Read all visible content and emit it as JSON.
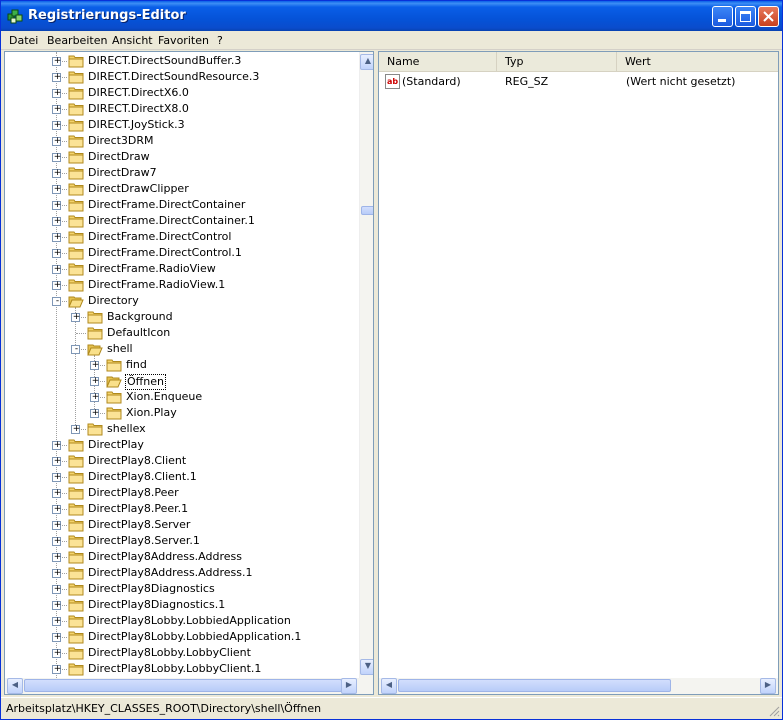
{
  "window": {
    "title": "Registrierungs-Editor"
  },
  "menu": [
    {
      "label": "Datei"
    },
    {
      "label": "Bearbeiten"
    },
    {
      "label": "Ansicht"
    },
    {
      "label": "Favoriten"
    },
    {
      "label": "?"
    }
  ],
  "tree": [
    {
      "label": "DIRECT.DirectSoundBuffer.3",
      "depth": 0,
      "expander": "+"
    },
    {
      "label": "DIRECT.DirectSoundResource.3",
      "depth": 0,
      "expander": "+"
    },
    {
      "label": "DIRECT.DirectX6.0",
      "depth": 0,
      "expander": "+"
    },
    {
      "label": "DIRECT.DirectX8.0",
      "depth": 0,
      "expander": "+"
    },
    {
      "label": "DIRECT.JoyStick.3",
      "depth": 0,
      "expander": "+"
    },
    {
      "label": "Direct3DRM",
      "depth": 0,
      "expander": "+"
    },
    {
      "label": "DirectDraw",
      "depth": 0,
      "expander": "+"
    },
    {
      "label": "DirectDraw7",
      "depth": 0,
      "expander": "+"
    },
    {
      "label": "DirectDrawClipper",
      "depth": 0,
      "expander": "+"
    },
    {
      "label": "DirectFrame.DirectContainer",
      "depth": 0,
      "expander": "+"
    },
    {
      "label": "DirectFrame.DirectContainer.1",
      "depth": 0,
      "expander": "+"
    },
    {
      "label": "DirectFrame.DirectControl",
      "depth": 0,
      "expander": "+"
    },
    {
      "label": "DirectFrame.DirectControl.1",
      "depth": 0,
      "expander": "+"
    },
    {
      "label": "DirectFrame.RadioView",
      "depth": 0,
      "expander": "+"
    },
    {
      "label": "DirectFrame.RadioView.1",
      "depth": 0,
      "expander": "+"
    },
    {
      "label": "Directory",
      "depth": 0,
      "expander": "-"
    },
    {
      "label": "Background",
      "depth": 1,
      "expander": "+"
    },
    {
      "label": "DefaultIcon",
      "depth": 1,
      "expander": ""
    },
    {
      "label": "shell",
      "depth": 1,
      "expander": "-"
    },
    {
      "label": "find",
      "depth": 2,
      "expander": "+"
    },
    {
      "label": "Öffnen",
      "depth": 2,
      "expander": "+",
      "selected": true
    },
    {
      "label": "Xion.Enqueue",
      "depth": 2,
      "expander": "+"
    },
    {
      "label": "Xion.Play",
      "depth": 2,
      "expander": "+"
    },
    {
      "label": "shellex",
      "depth": 1,
      "expander": "+"
    },
    {
      "label": "DirectPlay",
      "depth": 0,
      "expander": "+"
    },
    {
      "label": "DirectPlay8.Client",
      "depth": 0,
      "expander": "+"
    },
    {
      "label": "DirectPlay8.Client.1",
      "depth": 0,
      "expander": "+"
    },
    {
      "label": "DirectPlay8.Peer",
      "depth": 0,
      "expander": "+"
    },
    {
      "label": "DirectPlay8.Peer.1",
      "depth": 0,
      "expander": "+"
    },
    {
      "label": "DirectPlay8.Server",
      "depth": 0,
      "expander": "+"
    },
    {
      "label": "DirectPlay8.Server.1",
      "depth": 0,
      "expander": "+"
    },
    {
      "label": "DirectPlay8Address.Address",
      "depth": 0,
      "expander": "+"
    },
    {
      "label": "DirectPlay8Address.Address.1",
      "depth": 0,
      "expander": "+"
    },
    {
      "label": "DirectPlay8Diagnostics",
      "depth": 0,
      "expander": "+"
    },
    {
      "label": "DirectPlay8Diagnostics.1",
      "depth": 0,
      "expander": "+"
    },
    {
      "label": "DirectPlay8Lobby.LobbiedApplication",
      "depth": 0,
      "expander": "+"
    },
    {
      "label": "DirectPlay8Lobby.LobbiedApplication.1",
      "depth": 0,
      "expander": "+"
    },
    {
      "label": "DirectPlay8Lobby.LobbyClient",
      "depth": 0,
      "expander": "+"
    },
    {
      "label": "DirectPlay8Lobby.LobbyClient.1",
      "depth": 0,
      "expander": "+"
    }
  ],
  "list": {
    "columns": [
      "Name",
      "Typ",
      "Wert"
    ],
    "rows": [
      {
        "name": "(Standard)",
        "type": "REG_SZ",
        "value": "(Wert nicht gesetzt)"
      }
    ]
  },
  "status": {
    "path": "Arbeitsplatz\\HKEY_CLASSES_ROOT\\Directory\\shell\\Öffnen"
  },
  "icons": {
    "app": "registry-editor-icon",
    "folder": "folder-icon",
    "value": "string-value-icon"
  },
  "colors": {
    "titlebar": "#0a5fe8",
    "folder": "#f4d36b",
    "pane_border": "#7f9db9"
  }
}
